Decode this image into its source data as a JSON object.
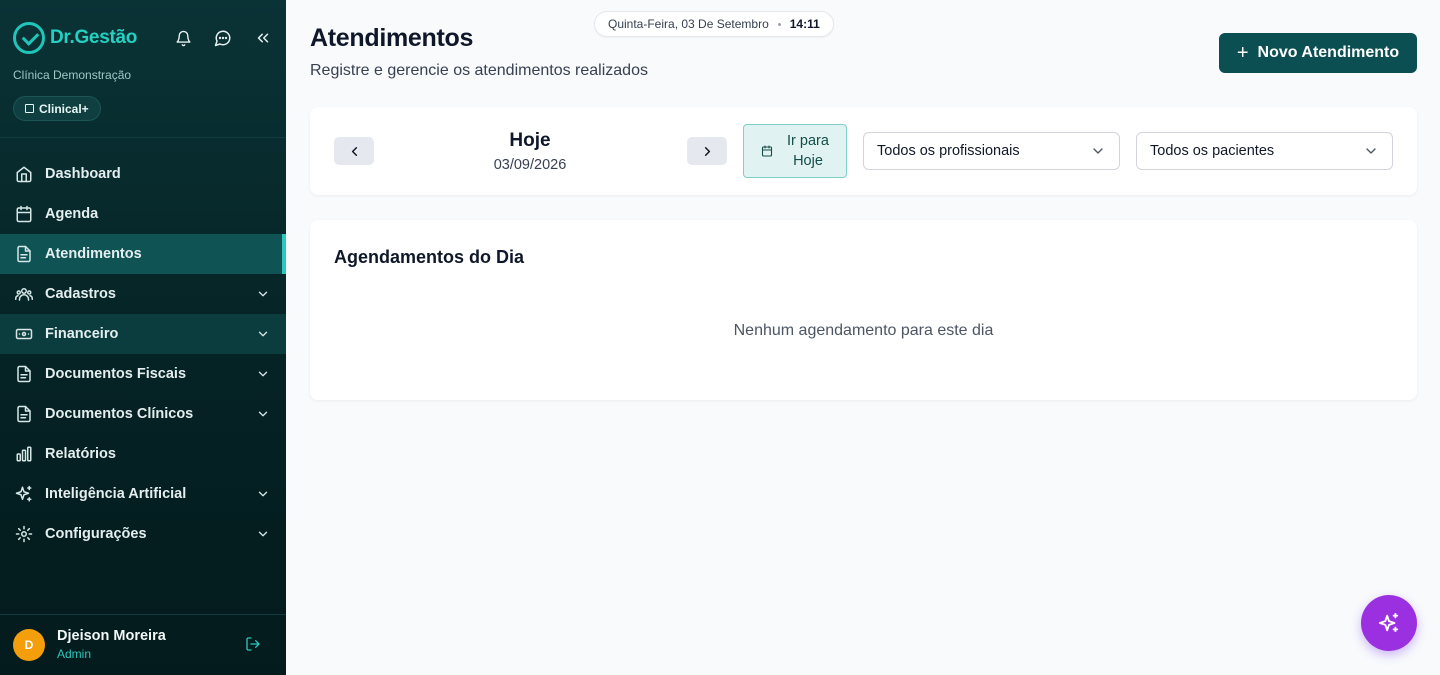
{
  "brand": {
    "name": "Dr.Gestão",
    "clinic": "Clínica Demonstração",
    "plan": "Clinical+"
  },
  "header": {
    "date": "Quinta-Feira, 03 De Setembro",
    "time": "14:11"
  },
  "nav": [
    {
      "label": "Dashboard",
      "icon": "home-icon",
      "chevron": false
    },
    {
      "label": "Agenda",
      "icon": "calendar-icon",
      "chevron": false
    },
    {
      "label": "Atendimentos",
      "icon": "document-icon",
      "chevron": false,
      "active": true
    },
    {
      "label": "Cadastros",
      "icon": "users-icon",
      "chevron": true
    },
    {
      "label": "Financeiro",
      "icon": "wallet-icon",
      "chevron": true
    },
    {
      "label": "Documentos Fiscais",
      "icon": "document-icon",
      "chevron": true
    },
    {
      "label": "Documentos Clínicos",
      "icon": "document-icon",
      "chevron": true
    },
    {
      "label": "Relatórios",
      "icon": "bar-chart-icon",
      "chevron": false
    },
    {
      "label": "Inteligência Artificial",
      "icon": "sparkles-icon",
      "chevron": true
    },
    {
      "label": "Configurações",
      "icon": "gear-icon",
      "chevron": true
    }
  ],
  "user": {
    "initial": "D",
    "name": "Djeison Moreira",
    "role": "Admin"
  },
  "page": {
    "title": "Atendimentos",
    "subtitle": "Registre e gerencie os atendimentos realizados",
    "new_button": "Novo Atendimento"
  },
  "filters": {
    "day_label": "Hoje",
    "day_date": "03/09/2026",
    "today_button": [
      "Ir para",
      "Hoje"
    ],
    "professional": "Todos os profissionais",
    "patient": "Todos os pacientes"
  },
  "list": {
    "title": "Agendamentos do Dia",
    "empty": "Nenhum agendamento para este dia"
  },
  "colors": {
    "sidebar": "#052224",
    "accent": "#2fc6bb",
    "primary": "#0b4f52",
    "fab": "#9b30e0"
  }
}
